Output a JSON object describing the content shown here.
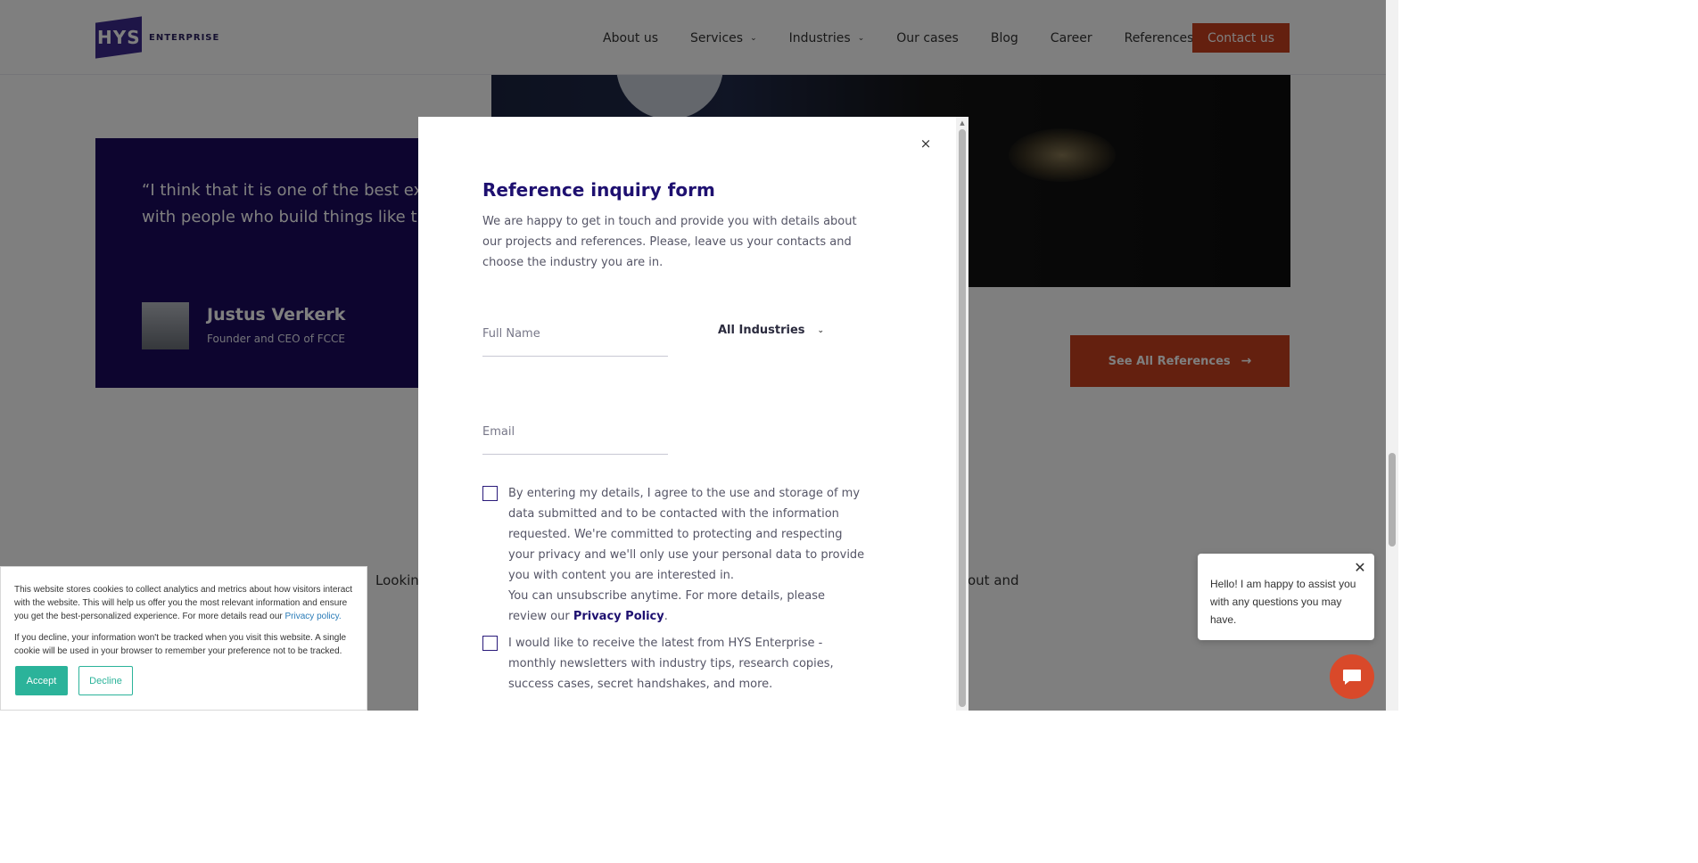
{
  "header": {
    "logo_mark": "HYS",
    "logo_text": "ENTERPRISE",
    "nav": [
      {
        "label": "About us"
      },
      {
        "label": "Services"
      },
      {
        "label": "Industries"
      },
      {
        "label": "Our cases"
      },
      {
        "label": "Blog"
      },
      {
        "label": "Career"
      },
      {
        "label": "References"
      }
    ],
    "contact_label": "Contact us"
  },
  "testimonial": {
    "quote": "“I think that it is one of the best ex with people who build things like t",
    "quote_line1": "“I think that it is one of the best ex",
    "quote_line2": "with people who build things like t",
    "author_name": "Justus Verkerk",
    "author_role": "Founder and CEO of FCCE"
  },
  "see_all_label": "See All References",
  "background_text": {
    "left": "Looking",
    "right": "out and"
  },
  "modal": {
    "title": "Reference inquiry form",
    "intro": "We are happy to get in touch and provide you with details about our projects and references. Please, leave us your contacts and choose the industry you are in.",
    "full_name_placeholder": "Full Name",
    "email_placeholder": "Email",
    "industry_selected": "All Industries",
    "consent_text": "By entering my details, I agree to the use and storage of my data submitted and to be contacted with the information requested. We're committed to protecting and respecting your privacy and we'll only use your personal data to provide you with content you are interested in.",
    "unsubscribe_text": "You can unsubscribe anytime. For more details, please review our",
    "privacy_link": "Privacy Policy",
    "newsletter_text": "I would like to receive the latest from HYS Enterprise - monthly newsletters with industry tips, research copies, success cases, secret handshakes, and more.",
    "close_symbol": "×"
  },
  "cookie": {
    "text1": "This website stores cookies to collect analytics and metrics about how visitors interact with the website. This will help us offer you the most relevant information and ensure you get the best-personalized experience. For more details read our",
    "privacy_link": "Privacy policy.",
    "text2": "If you decline, your information won't be tracked when you visit this website. A single cookie will be used in your browser to remember your preference not to be tracked.",
    "accept_label": "Accept",
    "decline_label": "Decline"
  },
  "chat": {
    "message": "Hello! I am happy to assist you with any questions you may have."
  },
  "colors": {
    "brand_purple": "#1a0a5e",
    "accent_orange": "#c8401f",
    "cookie_green": "#2bb39a"
  },
  "icons": [
    "chevron-down-icon",
    "arrow-right-icon",
    "close-icon",
    "chat-icon"
  ]
}
